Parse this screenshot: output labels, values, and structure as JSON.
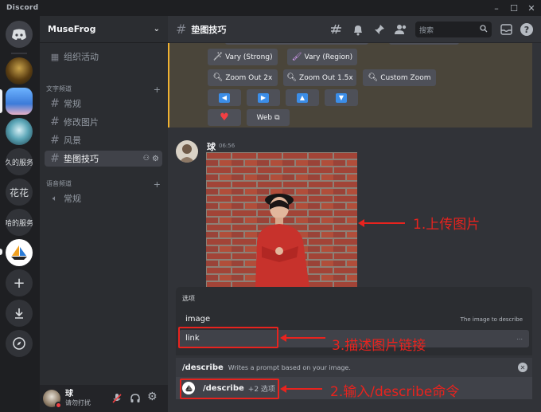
{
  "window": {
    "app_name": "Discord"
  },
  "rail": {
    "servers": [
      {
        "name": "home",
        "label": ""
      },
      {
        "name": "server-1",
        "label": ""
      },
      {
        "name": "server-2",
        "label": ""
      },
      {
        "name": "server-3",
        "label": ""
      },
      {
        "name": "server-4",
        "label": "久的服务"
      },
      {
        "name": "server-5",
        "label": "花花"
      },
      {
        "name": "server-6",
        "label": "哈的服务"
      },
      {
        "name": "server-7",
        "label": ""
      }
    ]
  },
  "sidebar": {
    "guild_name": "MuseFrog",
    "events_label": "组织活动",
    "text_category": "文字频道",
    "text_channels": [
      "常规",
      "修改图片",
      "风景",
      "垫图技巧"
    ],
    "voice_category": "语音频道",
    "voice_channels": [
      "常规"
    ]
  },
  "user": {
    "name": "球",
    "status": "请勿打扰"
  },
  "header": {
    "channel_name": "垫图技巧",
    "search_placeholder": "搜索"
  },
  "buttons": {
    "vary_strong": "Vary (Strong)",
    "vary_region": "Vary (Region)",
    "zoom_out_2x": "Zoom Out 2x",
    "zoom_out_15x": "Zoom Out 1.5x",
    "custom_zoom": "Custom Zoom",
    "web": "Web"
  },
  "message": {
    "author": "球",
    "time": "06:56"
  },
  "options_panel": {
    "title": "选项",
    "option_name": "image",
    "option_hint": "The image to describe",
    "input_value": "link",
    "input_tail": "..."
  },
  "command": {
    "name": "/describe",
    "description": "Writes a prompt based on your image.",
    "entry_name": "/describe",
    "entry_extra": "+2 选项"
  },
  "annotations": {
    "step1": "1.上传图片",
    "step2": "2.输入/describe命令",
    "step3": "3.描述图片链接"
  },
  "colors": {
    "accent_red": "#e8231e",
    "highlight_border": "#f0b232",
    "blurple": "#3b8de8"
  }
}
